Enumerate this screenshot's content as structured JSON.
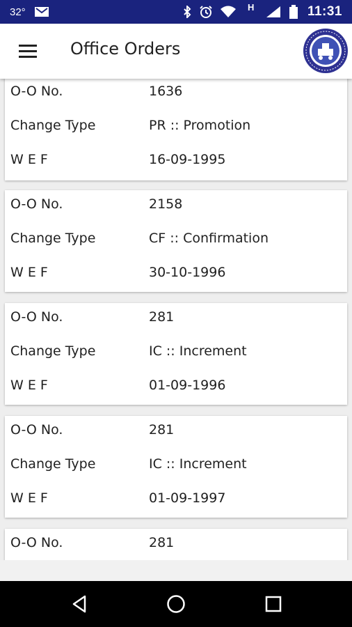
{
  "status_bar": {
    "temperature": "32°",
    "network_label": "H",
    "time": "11:31",
    "icons": [
      "mail-icon",
      "bluetooth-icon",
      "alarm-icon",
      "wifi-icon",
      "signal-icon",
      "battery-icon"
    ]
  },
  "app_bar": {
    "title": "Office Orders",
    "menu_icon": "hamburger-menu-icon",
    "logo_icon": "indian-railways-logo"
  },
  "labels": {
    "order_no": "O-O No.",
    "change_type": "Change Type",
    "wef": "W E F"
  },
  "orders": [
    {
      "order_no": "1636",
      "change_type": "PR :: Promotion",
      "wef": "16-09-1995"
    },
    {
      "order_no": "2158",
      "change_type": "CF :: Confirmation",
      "wef": "30-10-1996"
    },
    {
      "order_no": "281",
      "change_type": "IC :: Increment",
      "wef": "01-09-1996"
    },
    {
      "order_no": "281",
      "change_type": "IC :: Increment",
      "wef": "01-09-1997"
    },
    {
      "order_no": "281"
    }
  ],
  "nav_bar": {
    "icons": [
      "back-icon",
      "home-icon",
      "recents-icon"
    ]
  },
  "colors": {
    "status_bar": "#1a237e",
    "app_bar": "#ffffff",
    "background": "#eeeeee",
    "card": "#ffffff",
    "text": "#212121",
    "nav_bar": "#000000"
  }
}
